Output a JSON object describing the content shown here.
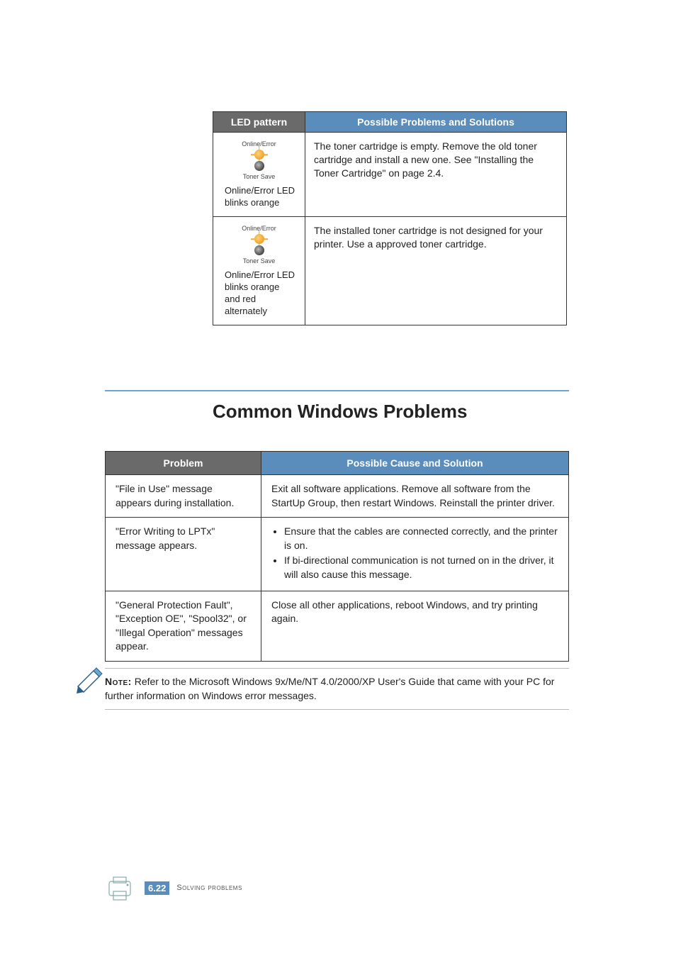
{
  "led_table": {
    "headers": {
      "left": "LED pattern",
      "right": "Possible Problems and Solutions"
    },
    "rows": [
      {
        "icon_top_label": "Online/Error",
        "icon_bottom_label": "Toner Save",
        "caption": "Online/Error LED blinks orange",
        "solution": "The toner cartridge is empty. Remove the old toner cartridge and install a new one. See \"Installing the Toner Cartridge\" on page 2.4."
      },
      {
        "icon_top_label": "Online/Error",
        "icon_bottom_label": "Toner Save",
        "caption": "Online/Error LED blinks orange and red alternately",
        "solution": "The installed toner cartridge is not designed for your printer. Use a approved toner cartridge."
      }
    ]
  },
  "heading": "Common Windows Problems",
  "win_table": {
    "headers": {
      "left": "Problem",
      "right": "Possible Cause and Solution"
    },
    "rows": [
      {
        "problem": "\"File in Use\" message appears during installation.",
        "solution_text": "Exit all software applications. Remove all software from the StartUp Group, then restart Windows. Reinstall the printer driver."
      },
      {
        "problem": "\"Error Writing to LPTx\" message appears.",
        "bullets": [
          "Ensure that the cables are connected correctly, and the printer is on.",
          "If bi-directional communication is not turned on in the driver, it will also cause this message."
        ]
      },
      {
        "problem": "\"General Protection Fault\", \"Exception OE\", \"Spool32\", or \"Illegal Operation\" messages appear.",
        "solution_text": "Close all other applications, reboot Windows, and try printing again."
      }
    ]
  },
  "note": {
    "label": "Note:",
    "body": " Refer to the Microsoft Windows 9x/Me/NT 4.0/2000/XP User's Guide that came with your PC for further information on Windows error messages."
  },
  "footer": {
    "page_ch": "6.",
    "page_num": "22",
    "section": "Solving problems"
  }
}
